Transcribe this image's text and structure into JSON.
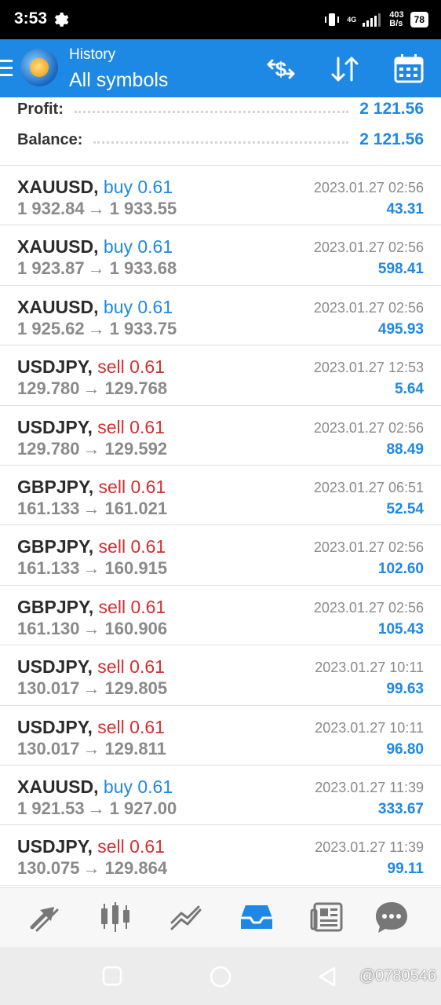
{
  "status_bar": {
    "time": "3:53",
    "network": "4G",
    "speed_value": "403",
    "speed_unit": "B/s",
    "battery": "78"
  },
  "app_bar": {
    "subtitle": "History",
    "title": "All symbols"
  },
  "summary": {
    "profit_label": "Profit:",
    "profit_value": "2 121.56",
    "balance_label": "Balance:",
    "balance_value": "2 121.56"
  },
  "trades": [
    {
      "symbol": "XAUUSD,",
      "side": "buy 0.61",
      "open": "1 932.84",
      "close": "1 933.55",
      "date": "2023.01.27 02:56",
      "profit": "43.31"
    },
    {
      "symbol": "XAUUSD,",
      "side": "buy 0.61",
      "open": "1 923.87",
      "close": "1 933.68",
      "date": "2023.01.27 02:56",
      "profit": "598.41"
    },
    {
      "symbol": "XAUUSD,",
      "side": "buy 0.61",
      "open": "1 925.62",
      "close": "1 933.75",
      "date": "2023.01.27 02:56",
      "profit": "495.93"
    },
    {
      "symbol": "USDJPY,",
      "side": "sell 0.61",
      "open": "129.780",
      "close": "129.768",
      "date": "2023.01.27 12:53",
      "profit": "5.64"
    },
    {
      "symbol": "USDJPY,",
      "side": "sell 0.61",
      "open": "129.780",
      "close": "129.592",
      "date": "2023.01.27 02:56",
      "profit": "88.49"
    },
    {
      "symbol": "GBPJPY,",
      "side": "sell 0.61",
      "open": "161.133",
      "close": "161.021",
      "date": "2023.01.27 06:51",
      "profit": "52.54"
    },
    {
      "symbol": "GBPJPY,",
      "side": "sell 0.61",
      "open": "161.133",
      "close": "160.915",
      "date": "2023.01.27 02:56",
      "profit": "102.60"
    },
    {
      "symbol": "GBPJPY,",
      "side": "sell 0.61",
      "open": "161.130",
      "close": "160.906",
      "date": "2023.01.27 02:56",
      "profit": "105.43"
    },
    {
      "symbol": "USDJPY,",
      "side": "sell 0.61",
      "open": "130.017",
      "close": "129.805",
      "date": "2023.01.27 10:11",
      "profit": "99.63"
    },
    {
      "symbol": "USDJPY,",
      "side": "sell 0.61",
      "open": "130.017",
      "close": "129.811",
      "date": "2023.01.27 10:11",
      "profit": "96.80"
    },
    {
      "symbol": "XAUUSD,",
      "side": "buy 0.61",
      "open": "1 921.53",
      "close": "1 927.00",
      "date": "2023.01.27 11:39",
      "profit": "333.67"
    },
    {
      "symbol": "USDJPY,",
      "side": "sell 0.61",
      "open": "130.075",
      "close": "129.864",
      "date": "2023.01.27 11:39",
      "profit": "99.11"
    }
  ],
  "price_arrow": "→",
  "watermark": "@0780546",
  "colors": {
    "accent": "#1e88e5",
    "buy": "#1e88e5",
    "sell": "#d32f2f",
    "muted": "#8a8a8a"
  },
  "bottom_nav_icons": [
    "trade-icon",
    "quotes-icon",
    "chart-icon",
    "history-icon",
    "news-icon",
    "chat-icon"
  ]
}
